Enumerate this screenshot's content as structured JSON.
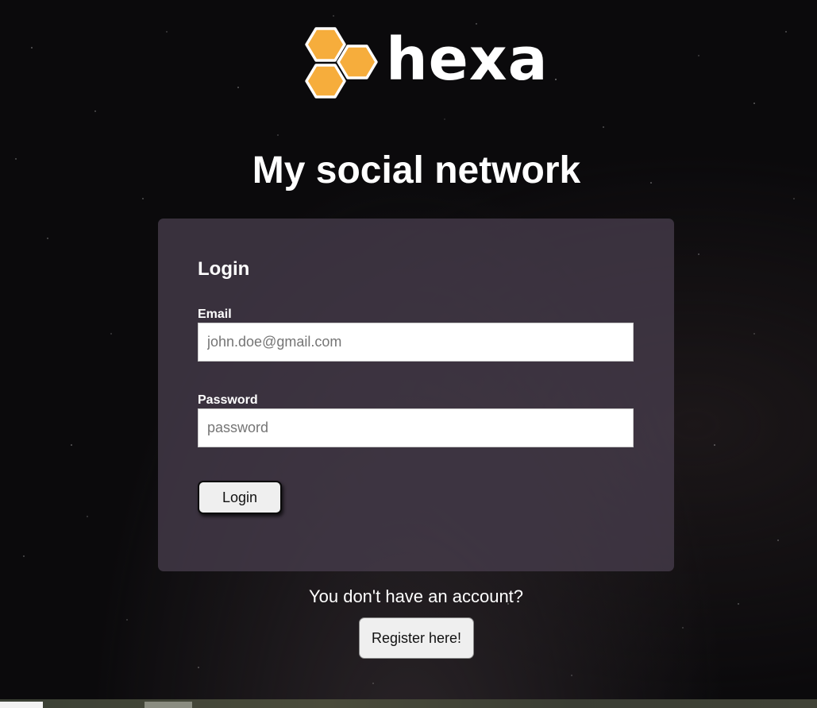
{
  "brand": {
    "logo_text": "hexa",
    "logo_color": "#f6ad3c"
  },
  "page_title": "My social network",
  "login_form": {
    "title": "Login",
    "email_label": "Email",
    "email_placeholder": "john.doe@gmail.com",
    "email_value": "",
    "password_label": "Password",
    "password_placeholder": "password",
    "password_value": "",
    "submit_label": "Login"
  },
  "register": {
    "prompt": "You don't have an account?",
    "button_label": "Register here!"
  },
  "colors": {
    "background": "#0b0a0c",
    "card": "#463c4c",
    "text": "#ffffff",
    "button": "#efefef"
  }
}
